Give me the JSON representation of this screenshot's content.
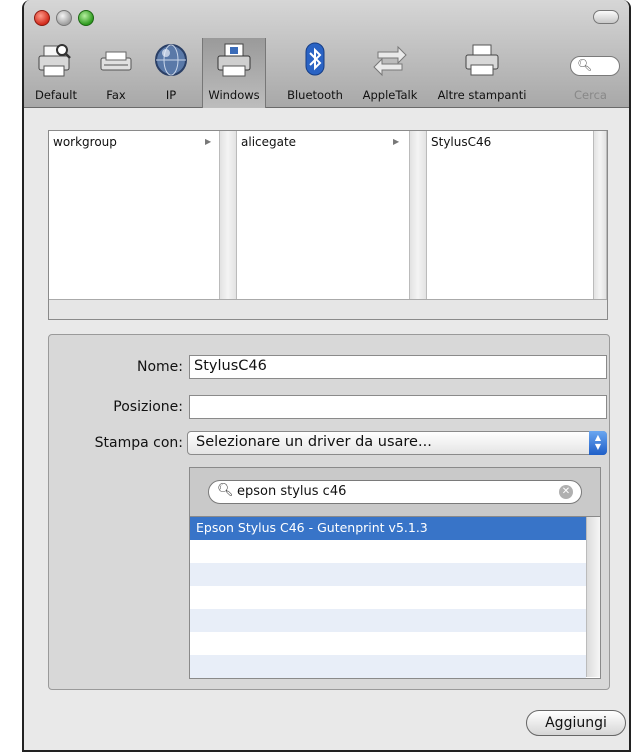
{
  "toolbar": {
    "items": [
      {
        "label": "Default",
        "icon": "printer-default-icon"
      },
      {
        "label": "Fax",
        "icon": "fax-icon"
      },
      {
        "label": "IP",
        "icon": "ip-globe-icon"
      },
      {
        "label": "Windows",
        "icon": "windows-printer-icon",
        "selected": true
      },
      {
        "label": "Bluetooth",
        "icon": "bluetooth-icon"
      },
      {
        "label": "AppleTalk",
        "icon": "appletalk-arrows-icon"
      },
      {
        "label": "Altre stampanti",
        "icon": "printer-more-icon"
      }
    ],
    "search_label": "Cerca"
  },
  "browser": {
    "columns": [
      "workgroup",
      "alicegate",
      "StylusC46"
    ]
  },
  "form": {
    "name_label": "Nome:",
    "name_value": "StylusC46",
    "location_label": "Posizione:",
    "location_value": "",
    "print_using_label": "Stampa con:",
    "print_using_value": "Selezionare un driver da usare..."
  },
  "driver": {
    "search_value": "epson stylus c46",
    "results": [
      "Epson Stylus C46 - Gutenprint v5.1.3"
    ]
  },
  "buttons": {
    "add": "Aggiungi"
  },
  "colors": {
    "selection": "#3874c8",
    "accent_blue": "#1f5fc8"
  }
}
